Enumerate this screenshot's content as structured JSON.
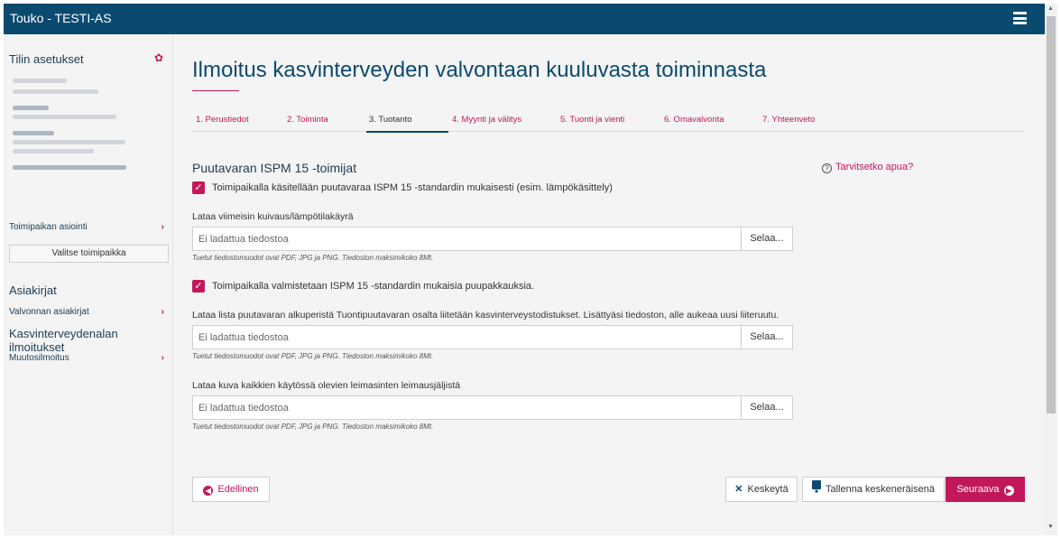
{
  "app": {
    "title": "Touko - TESTI-AS"
  },
  "sidebar": {
    "account_heading": "Tilin asetukset",
    "site_business": "Toimipaikan asiointi",
    "select_site": "Valitse toimipaikka",
    "documents_heading": "Asiakirjat",
    "supervision_docs": "Valvonnan asiakirjat",
    "notifications_heading": "Kasvinterveydenalan ilmoitukset",
    "change_notification": "Muutosilmoitus"
  },
  "main": {
    "page_title": "Ilmoitus kasvinterveyden valvontaan kuuluvasta toiminnasta",
    "steps": [
      {
        "label": "1. Perustiedot"
      },
      {
        "label": "2. Toiminta"
      },
      {
        "label": "3. Tuotanto"
      },
      {
        "label": "4. Myynti ja välitys"
      },
      {
        "label": "5. Tuonti ja vienti"
      },
      {
        "label": "6. Omavalvonta"
      },
      {
        "label": "7. Yhteenveto"
      }
    ],
    "active_step": 3,
    "section_title": "Puutavaran ISPM 15 -toimijat",
    "help_link": "Tarvitsetko apua?",
    "check1": {
      "label": "Toimipaikalla käsitellään puutavaraa ISPM 15 -standardin mukaisesti (esim. lämpökäsittely)",
      "checked": true
    },
    "upload1": {
      "label": "Lataa viimeisin kuivaus/lämpötilakäyrä",
      "placeholder": "Ei ladattua tiedostoa",
      "browse": "Selaa...",
      "hint": "Tuetut tiedostomuodot ovat PDF, JPG ja PNG. Tiedoston maksimikoko 8Mt."
    },
    "check2": {
      "label": "Toimipaikalla valmistetaan ISPM 15 -standardin mukaisia puupakkauksia.",
      "checked": true
    },
    "upload2": {
      "label": "Lataa lista puutavaran alkuperistä Tuontipuutavaran osalta liitetään kasvinterveystodistukset. Lisättyäsi tiedoston, alle aukeaa uusi liiteruutu.",
      "placeholder": "Ei ladattua tiedostoa",
      "browse": "Selaa...",
      "hint": "Tuetut tiedostomuodot ovat PDF, JPG ja PNG. Tiedoston maksimikoko 8Mt."
    },
    "upload3": {
      "label": "Lataa kuva kaikkien käytössä olevien leimasinten leimausjäljistä",
      "placeholder": "Ei ladattua tiedostoa",
      "browse": "Selaa...",
      "hint": "Tuetut tiedostomuodot ovat PDF, JPG ja PNG. Tiedoston maksimikoko 8Mt."
    }
  },
  "actions": {
    "previous": "Edellinen",
    "cancel": "Keskeytä",
    "save_draft": "Tallenna keskeneräisenä",
    "next": "Seuraava"
  },
  "colors": {
    "topbar": "#0b4a6f",
    "accent": "#c2185b",
    "heading": "#0b4a6f"
  }
}
